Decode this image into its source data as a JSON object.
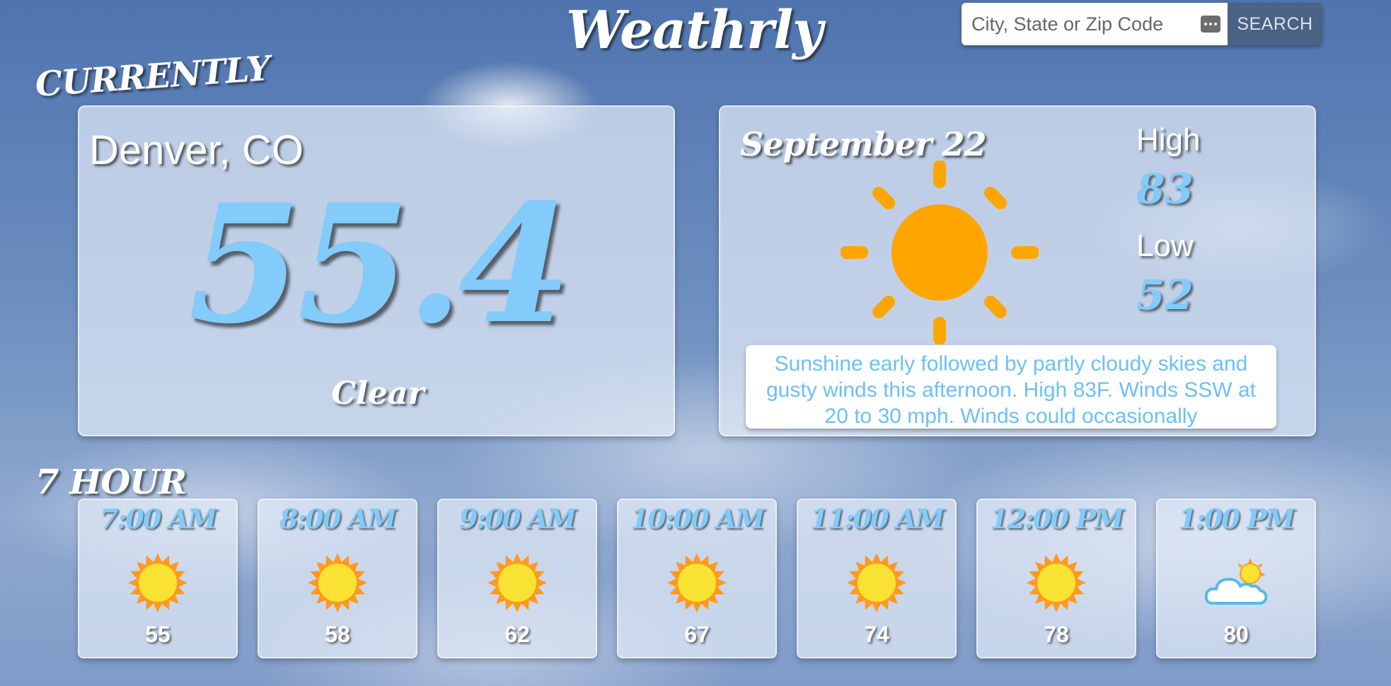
{
  "app": {
    "logo": "Weathrly"
  },
  "search": {
    "placeholder": "City, State or Zip Code",
    "value": "",
    "button_label": "SEARCH",
    "autofill_icon": "dots-icon"
  },
  "current": {
    "section_label": "CURRENTLY",
    "city": "Denver, CO",
    "temperature": "55.4",
    "condition": "Clear"
  },
  "forecast": {
    "date": "September 22",
    "icon": "sun-icon",
    "high_label": "High",
    "high": "83",
    "low_label": "Low",
    "low": "52",
    "summary": "Sunshine early followed by partly cloudy skies and gusty winds this afternoon. High 83F. Winds SSW at 20 to 30 mph. Winds could occasionally"
  },
  "hourly": {
    "section_label": "7 HOUR",
    "hours": [
      {
        "time": "7:00 AM",
        "icon": "sunny-icon",
        "temp": "55"
      },
      {
        "time": "8:00 AM",
        "icon": "sunny-icon",
        "temp": "58"
      },
      {
        "time": "9:00 AM",
        "icon": "sunny-icon",
        "temp": "62"
      },
      {
        "time": "10:00 AM",
        "icon": "sunny-icon",
        "temp": "67"
      },
      {
        "time": "11:00 AM",
        "icon": "sunny-icon",
        "temp": "74"
      },
      {
        "time": "12:00 PM",
        "icon": "sunny-icon",
        "temp": "78"
      },
      {
        "time": "1:00 PM",
        "icon": "partly-cloudy-icon",
        "temp": "80"
      }
    ]
  },
  "colors": {
    "accent_blue": "#82cbfa",
    "summary_text": "#6cc0f5",
    "sun_orange": "#ffa500",
    "search_button": "#4a6283"
  }
}
